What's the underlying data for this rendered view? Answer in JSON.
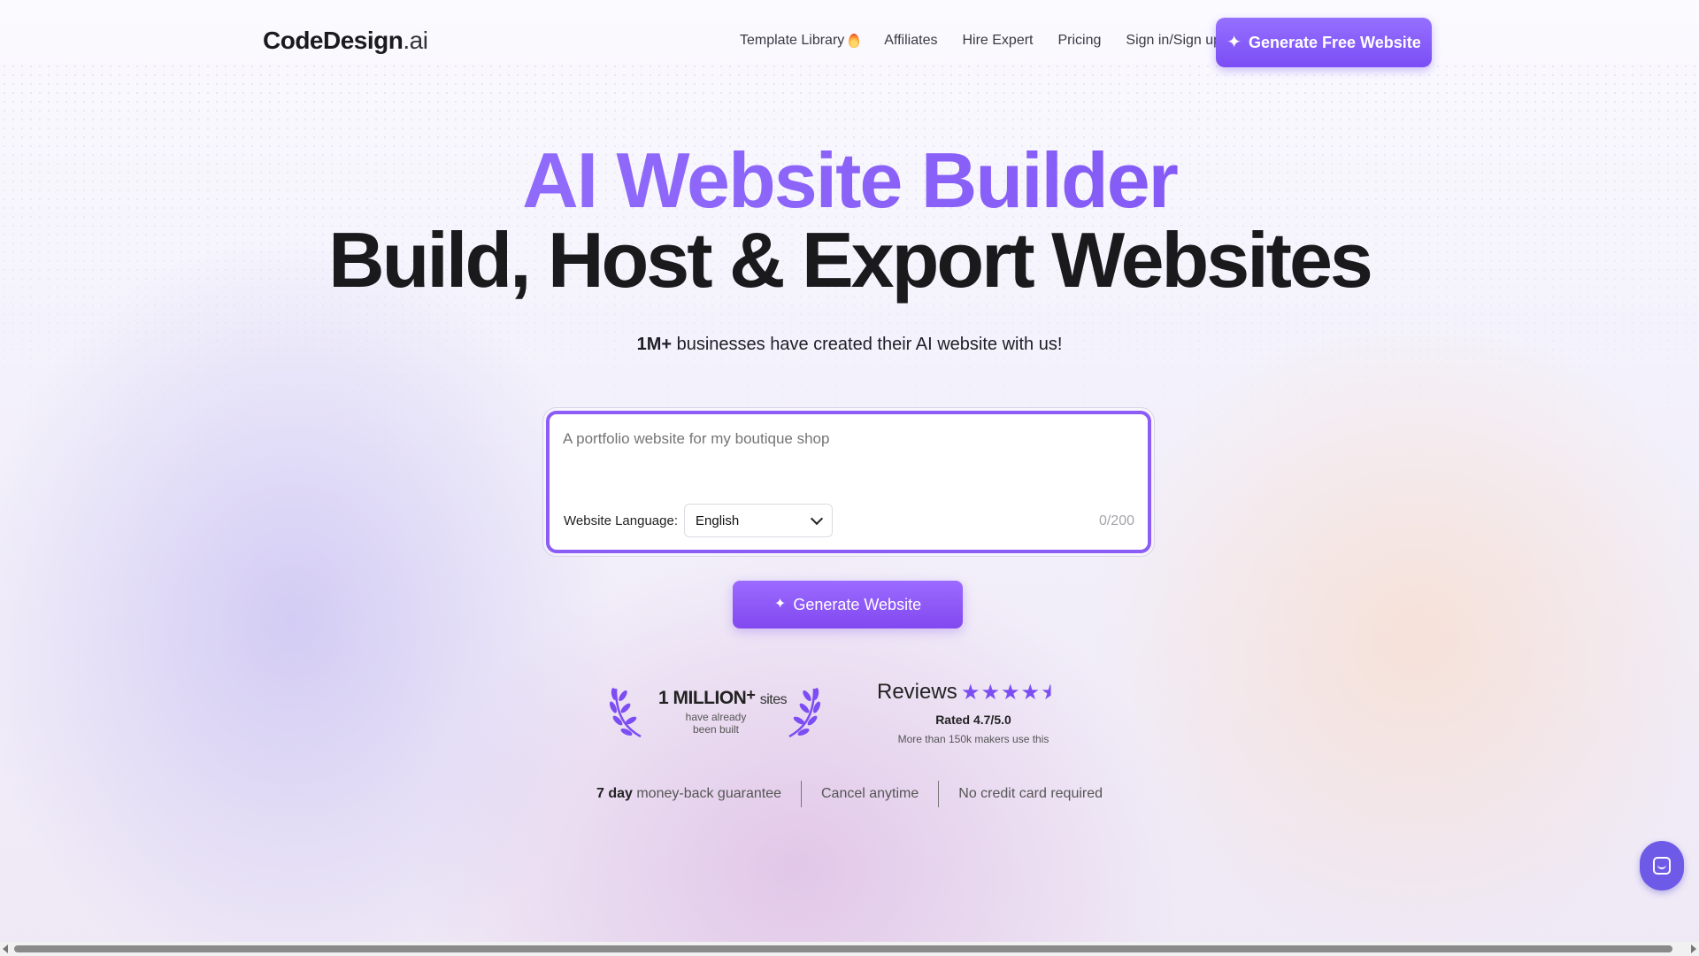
{
  "header": {
    "logo_main": "CodeDesign",
    "logo_ext": ".ai",
    "nav": [
      {
        "label": "Template Library",
        "icon": "fire-icon"
      },
      {
        "label": "Affiliates"
      },
      {
        "label": "Hire Expert"
      },
      {
        "label": "Pricing"
      },
      {
        "label": "Sign in/Sign up"
      }
    ],
    "cta_label": "Generate Free Website",
    "cta_icon": "sparkle-icon"
  },
  "hero": {
    "title": "AI Website Builder",
    "subtitle": "Build, Host & Export Websites",
    "tagline_bold": "1M+",
    "tagline_rest": " businesses have created their AI website with us!"
  },
  "generator": {
    "prompt_placeholder": "A portfolio website for my boutique shop",
    "language_label": "Website Language:",
    "language_value": "English",
    "counter": "0/200",
    "button_label": "Generate Website"
  },
  "social_proof": {
    "million_count": "1 MILLION",
    "million_plus": "+",
    "million_unit": "sites",
    "million_caption_1": "have already",
    "million_caption_2": "been built",
    "reviews_title": "Reviews",
    "stars_full": "★★★★",
    "stars_half": "★",
    "star_rating": 4.7,
    "rated": "Rated 4.7/5.0",
    "makers": "More than 150k makers use this"
  },
  "guarantees": {
    "g1_bold": "7 day",
    "g1_rest": " money-back guarantee",
    "g2": "Cancel anytime",
    "g3": "No credit card required"
  },
  "colors": {
    "accent": "#8b5cf6",
    "accent_dark": "#7b4df2",
    "chat_button": "#6d5ae6"
  }
}
